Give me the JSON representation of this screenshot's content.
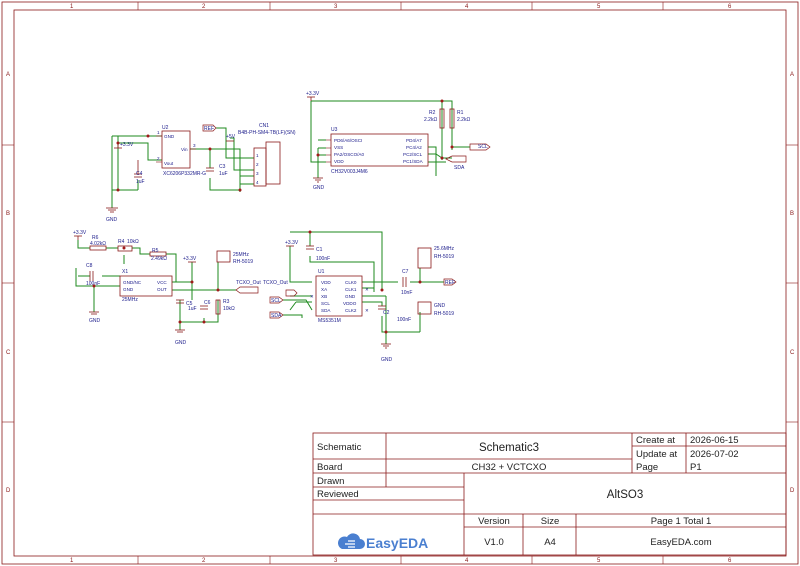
{
  "app": "EasyEDA",
  "zones": {
    "columns": [
      "1",
      "2",
      "3",
      "4",
      "5",
      "6"
    ],
    "rows": [
      "A",
      "B",
      "C",
      "D"
    ]
  },
  "title_block": {
    "schematic_label": "Schematic",
    "schematic_name": "Schematic3",
    "board_label": "Board",
    "board_name": "CH32 + VCTCXO",
    "create_label": "Create at",
    "create_date": "2026-06-15",
    "update_label": "Update at",
    "update_date": "2026-07-02",
    "page_label": "Page",
    "page_value": "P1",
    "drawn_label": "Drawn",
    "reviewed_label": "Reviewed",
    "project_name": "AltSO3",
    "version_label": "Version",
    "version_value": "V1.0",
    "size_label": "Size",
    "size_value": "A4",
    "page_total": "Page  1  Total  1",
    "logo_text": "EasyEDA",
    "site": "EasyEDA.com"
  },
  "regulator": {
    "u2_ref": "U2",
    "u2_part": "XC6206P332MR-G",
    "pin_gnd": "GND",
    "pin_vin": "Vin",
    "pin_vout": "Vout",
    "pin_num_1": "1",
    "pin_num_2": "2",
    "pin_num_3": "3",
    "c4_ref": "C4",
    "c4_val": "1uF",
    "c3_ref": "C3",
    "c3_val": "1uF",
    "rail_33": "+3.3V",
    "rail_5": "+5V",
    "ref_flag": "REF",
    "cn1_ref": "CN1",
    "cn1_part": "B4B-PH-SM4-TB(LF)(SN)",
    "cn1_pins": [
      "1",
      "2",
      "3",
      "4"
    ],
    "gnd": "GND"
  },
  "mcu": {
    "rail": "+3.3V",
    "u3_ref": "U3",
    "u3_part": "CH32V003J4M6",
    "left_pins": [
      "PD6/A6/OSCI",
      "VSS",
      "PA2/OSCO/A0",
      "VDD"
    ],
    "right_pins": [
      "PD4/A7",
      "PC4/A2",
      "PC2/SCL",
      "PC1/SDA"
    ],
    "r2_ref": "R2",
    "r2_val": "2.2kΩ",
    "r1_ref": "R1",
    "r1_val": "2.2kΩ",
    "scl": "SCL",
    "sda": "SDA",
    "gnd": "GND"
  },
  "oscillator": {
    "rail": "+3.3V",
    "r6_ref": "R6",
    "r6_val": "4.02kΩ",
    "r4_ref": "R4",
    "r4_val": "10kΩ",
    "r5_ref": "R5",
    "r5_val": "2.49kΩ",
    "c8_ref": "C8",
    "c8_val": "100nF",
    "x1_ref": "X1",
    "x1_freq": "25MHz",
    "x1_pins": [
      "GND/NC",
      "GND",
      "VCC",
      "OUT"
    ],
    "rail2": "+3.3V",
    "c5_ref": "C5",
    "c5_val": "1uF",
    "c6_ref": "C6",
    "r3_ref": "R3",
    "r3_val": "10kΩ",
    "conn_freq": "25MHz",
    "conn_part": "RH-5019",
    "tcxo_out": "TCXO_Out",
    "gnd": "GND"
  },
  "synth": {
    "rail": "+3.3V",
    "c1_ref": "C1",
    "c1_val": "100nF",
    "tcxo_in": "TCXO_Out",
    "u1_ref": "U1",
    "u1_part": "MS5351M",
    "left_pins": [
      "VDD",
      "XA",
      "XB",
      "SCL",
      "SDA"
    ],
    "right_pins": [
      "CLK0",
      "CLK1",
      "GND",
      "VDDO",
      "CLK2"
    ],
    "scl": "SCL",
    "sda": "SDA",
    "c2_ref": "C2",
    "c2_val": "100nF",
    "c7_ref": "C7",
    "c7_val": "10nF",
    "ref_flag": "REF",
    "conn1_freq": "25.6MHz",
    "conn1_part": "RH-5019",
    "conn2_label": "GND",
    "conn2_part": "RH-5019",
    "gnd": "GND"
  }
}
